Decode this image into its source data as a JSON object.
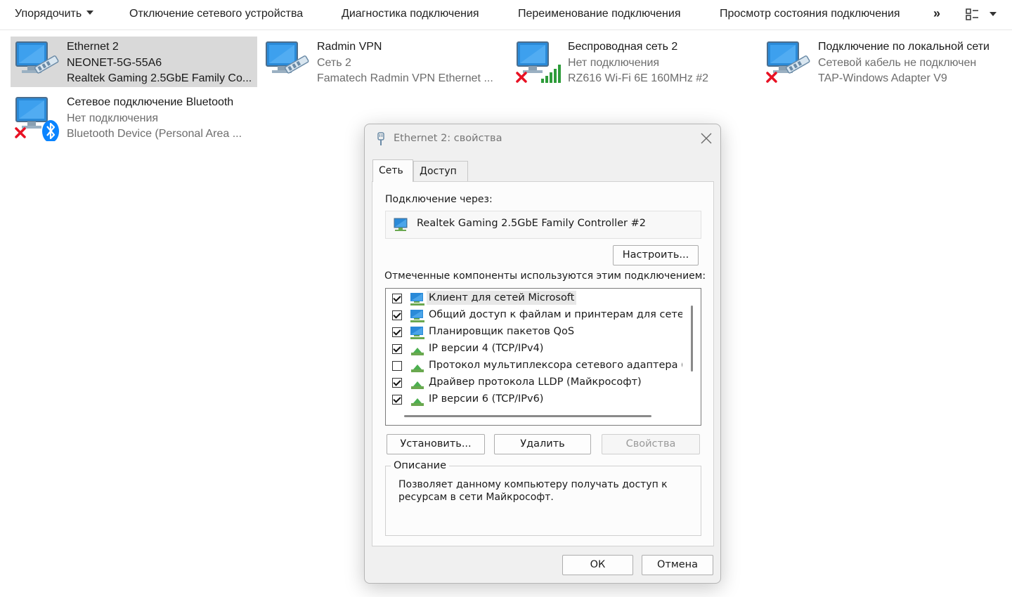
{
  "toolbar": {
    "organize": "Упорядочить",
    "disable": "Отключение сетевого устройства",
    "diagnose": "Диагностика подключения",
    "rename": "Переименование подключения",
    "status": "Просмотр состояния подключения",
    "more": "»"
  },
  "connections": [
    {
      "name": "Ethernet 2",
      "status": "NEONET-5G-55A6",
      "device": "Realtek Gaming 2.5GbE Family Co...",
      "icon": "ethernet-icon",
      "selected": true
    },
    {
      "name": "Radmin VPN",
      "status": "Сеть 2",
      "device": "Famatech Radmin VPN Ethernet ...",
      "icon": "ethernet-icon"
    },
    {
      "name": "Беспроводная сеть 2",
      "status": "Нет подключения",
      "device": "RZ616 Wi-Fi 6E 160MHz #2",
      "icon": "wifi-icon",
      "disconnected": true
    },
    {
      "name": "Подключение по локальной сети",
      "status": "Сетевой кабель не подключен",
      "device": "TAP-Windows Adapter V9",
      "icon": "ethernet-icon",
      "disconnected": true
    },
    {
      "name": "Сетевое подключение Bluetooth",
      "status": "Нет подключения",
      "device": "Bluetooth Device (Personal Area ...",
      "icon": "bluetooth-icon",
      "disconnected": true
    }
  ],
  "dialog": {
    "title": "Ethernet 2: свойства",
    "tabs": [
      "Сеть",
      "Доступ"
    ],
    "connect_using_label": "Подключение через:",
    "adapter_name": "Realtek Gaming 2.5GbE Family Controller #2",
    "configure_button": "Настроить...",
    "components_label": "Отмеченные компоненты используются этим подключением:",
    "components": [
      {
        "label": "Клиент для сетей Microsoft",
        "checked": true,
        "icon": "network-client-icon"
      },
      {
        "label": "Общий доступ к файлам и принтерам для сетей Mi",
        "checked": true,
        "icon": "network-client-icon"
      },
      {
        "label": "Планировщик пакетов QoS",
        "checked": true,
        "icon": "network-client-icon"
      },
      {
        "label": "IP версии 4 (TCP/IPv4)",
        "checked": true,
        "icon": "protocol-icon"
      },
      {
        "label": "Протокол мультиплексора сетевого адаптера (Май",
        "checked": false,
        "icon": "protocol-icon"
      },
      {
        "label": "Драйвер протокола LLDP (Майкрософт)",
        "checked": true,
        "icon": "protocol-icon"
      },
      {
        "label": "IP версии 6 (TCP/IPv6)",
        "checked": true,
        "icon": "protocol-icon"
      }
    ],
    "install_button": "Установить...",
    "remove_button": "Удалить",
    "properties_button": "Свойства",
    "description_legend": "Описание",
    "description_text": "Позволяет данному компьютеру получать доступ к ресурсам в сети Майкрософт.",
    "ok_button": "ОК",
    "cancel_button": "Отмена"
  },
  "colors": {
    "selected_tile": "#d9d9d9",
    "dialog_bg": "#f0f0f0",
    "error_red": "#e81123",
    "bluetooth_blue": "#0a84ff"
  }
}
